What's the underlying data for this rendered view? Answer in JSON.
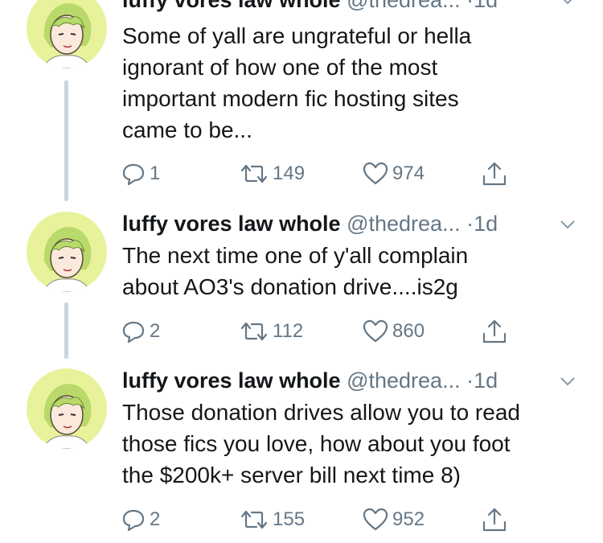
{
  "tweets": [
    {
      "name": "luffy vores law whole",
      "handle": "@thedrea...",
      "dot": "·",
      "time": "1d",
      "text": "Some of yall are ungrateful or hella\nignorant of how one of the most\nimportant modern fic hosting sites\ncame to be...",
      "replies": "1",
      "retweets": "149",
      "likes": "974"
    },
    {
      "name": "luffy vores law whole",
      "handle": "@thedrea...",
      "dot": "·",
      "time": "1d",
      "text": "The next time one of y'all complain\nabout AO3's donation drive....is2g",
      "replies": "2",
      "retweets": "112",
      "likes": "860"
    },
    {
      "name": "luffy vores law whole",
      "handle": "@thedrea...",
      "dot": "·",
      "time": "1d",
      "text": "Those donation drives allow you to read\nthose fics you love, how about you foot\nthe $200k+ server bill next time 8)",
      "replies": "2",
      "retweets": "155",
      "likes": "952"
    }
  ],
  "colors": {
    "text": "#14171a",
    "secondary": "#657786",
    "thread_line": "#ccd6dd",
    "avatar_bg": "#e8f29a",
    "hair": "#b9d96a"
  },
  "icons": {
    "reply": "reply-icon",
    "retweet": "retweet-icon",
    "like": "heart-icon",
    "share": "share-icon",
    "caret": "chevron-down-icon"
  }
}
